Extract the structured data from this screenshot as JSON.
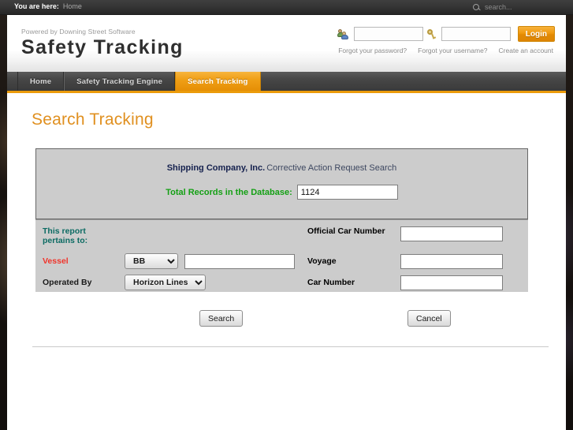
{
  "topbar": {
    "breadcrumb_label": "You are here:",
    "breadcrumb_current": "Home",
    "search_placeholder": "search...",
    "search_value": "",
    "search_icon": "search-icon"
  },
  "header": {
    "powered_by": "Powered by Downing Street Software",
    "site_title": "Safety Tracking",
    "login": {
      "username_icon": "users-icon",
      "username_value": "",
      "password_icon": "key-icon",
      "password_value": "",
      "login_button": "Login",
      "links": [
        "Forgot your password?",
        "Forgot your username?",
        "Create an account"
      ]
    }
  },
  "nav": {
    "items": [
      {
        "label": "Home",
        "active": false
      },
      {
        "label": "Safety Tracking Engine",
        "active": false
      },
      {
        "label": "Search Tracking",
        "active": true
      }
    ],
    "accent_color": "#eb9b0b"
  },
  "main": {
    "page_title": "Search Tracking",
    "info_panel": {
      "company": "Shipping Company, Inc.",
      "subtitle": "Corrective Action Request Search",
      "records_label": "Total Records in the Database:",
      "records_value": "1124"
    },
    "form": {
      "pertains_label_line1": "This report",
      "pertains_label_line2": "pertains to:",
      "vessel_label": "Vessel",
      "vessel_select_value": "BB",
      "vessel_select_options": [
        "BB"
      ],
      "vessel_text_value": "",
      "operated_by_label": "Operated By",
      "operated_by_value": "Horizon Lines",
      "operated_by_options": [
        "Horizon Lines"
      ],
      "official_car_number_label": "Official Car Number",
      "official_car_number_value": "",
      "voyage_label": "Voyage",
      "voyage_value": "",
      "car_number_label": "Car Number",
      "car_number_value": ""
    },
    "buttons": {
      "search": "Search",
      "cancel": "Cancel"
    }
  },
  "colors": {
    "accent_orange": "#e09020",
    "label_teal": "#0c6b63",
    "label_red": "#f0342b",
    "label_navy": "#16224f",
    "label_green": "#14a014",
    "panel_gray": "#cccccc"
  }
}
